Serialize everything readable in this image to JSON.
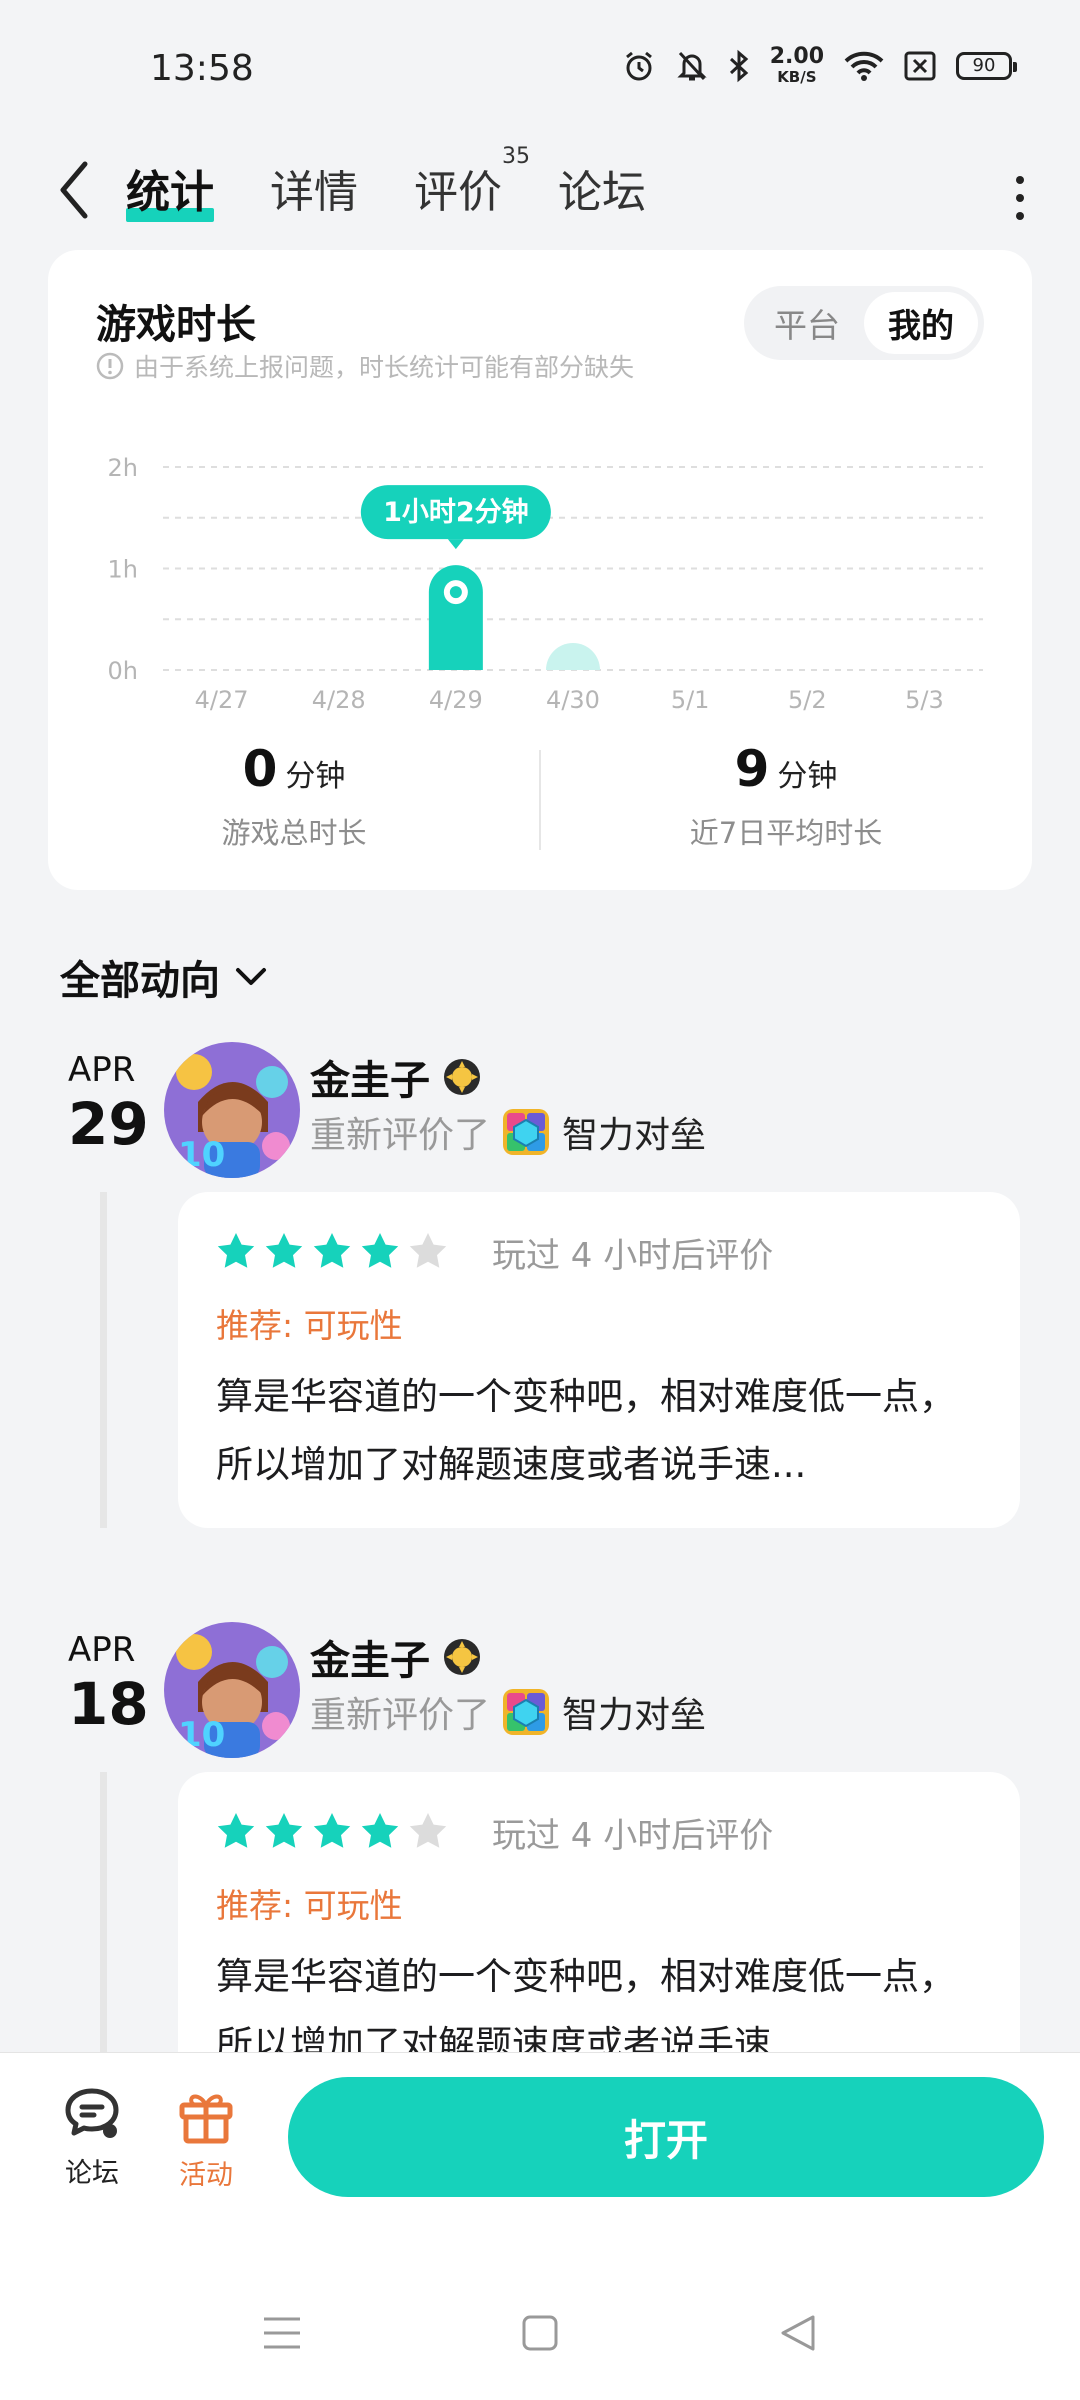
{
  "status_bar": {
    "time": "13:58",
    "net_speed_value": "2.00",
    "net_speed_unit": "KB/S",
    "battery": "90",
    "icons": [
      "alarm-icon",
      "mute-bell-icon",
      "bluetooth-icon",
      "wifi-icon",
      "sim-off-icon",
      "battery-icon"
    ]
  },
  "nav": {
    "tabs": [
      {
        "label": "统计",
        "active": true
      },
      {
        "label": "详情"
      },
      {
        "label": "评价",
        "badge": "35"
      },
      {
        "label": "论坛"
      }
    ]
  },
  "stats": {
    "title": "游戏时长",
    "notice": "由于系统上报问题，时长统计可能有部分缺失",
    "segment": {
      "options": [
        "平台",
        "我的"
      ],
      "selected": "我的"
    },
    "summary": [
      {
        "value": "0",
        "unit": "分钟",
        "label": "游戏总时长"
      },
      {
        "value": "9",
        "unit": "分钟",
        "label": "近7日平均时长"
      }
    ]
  },
  "chart_data": {
    "type": "bar",
    "categories": [
      "4/27",
      "4/28",
      "4/29",
      "4/30",
      "5/1",
      "5/2",
      "5/3"
    ],
    "values": [
      0,
      0,
      62,
      3,
      0,
      0,
      0
    ],
    "unit": "minutes",
    "y_ticks": [
      "0h",
      "1h",
      "2h"
    ],
    "ylim": [
      0,
      120
    ],
    "grid": true,
    "highlight": {
      "index": 2,
      "label": "1小时2分钟"
    },
    "colors": {
      "bar": "#16d2bb",
      "bar_light": "#c9f3ee"
    }
  },
  "activity": {
    "title": "全部动向",
    "items": [
      {
        "month": "APR",
        "day": "29",
        "user": "金圭子",
        "action": "重新评价了",
        "game": "智力对垒",
        "stars": 4,
        "max_stars": 5,
        "meta": "玩过 4 小时后评价",
        "recommend": "推荐: 可玩性",
        "text": "算是华容道的一个变种吧，相对难度低一点，所以增加了对解题速度或者说手速..."
      },
      {
        "month": "APR",
        "day": "18",
        "user": "金圭子",
        "action": "重新评价了",
        "game": "智力对垒",
        "stars": 4,
        "max_stars": 5,
        "meta": "玩过 4 小时后评价",
        "recommend": "推荐: 可玩性",
        "text": "算是华容道的一个变种吧，相对难度低一点，所以增加了对解题速度或者说手速..."
      }
    ]
  },
  "bottom_bar": {
    "forum_label": "论坛",
    "activity_label": "活动",
    "open_label": "打开"
  },
  "colors": {
    "accent": "#16d2bb",
    "orange": "#e9773b"
  }
}
